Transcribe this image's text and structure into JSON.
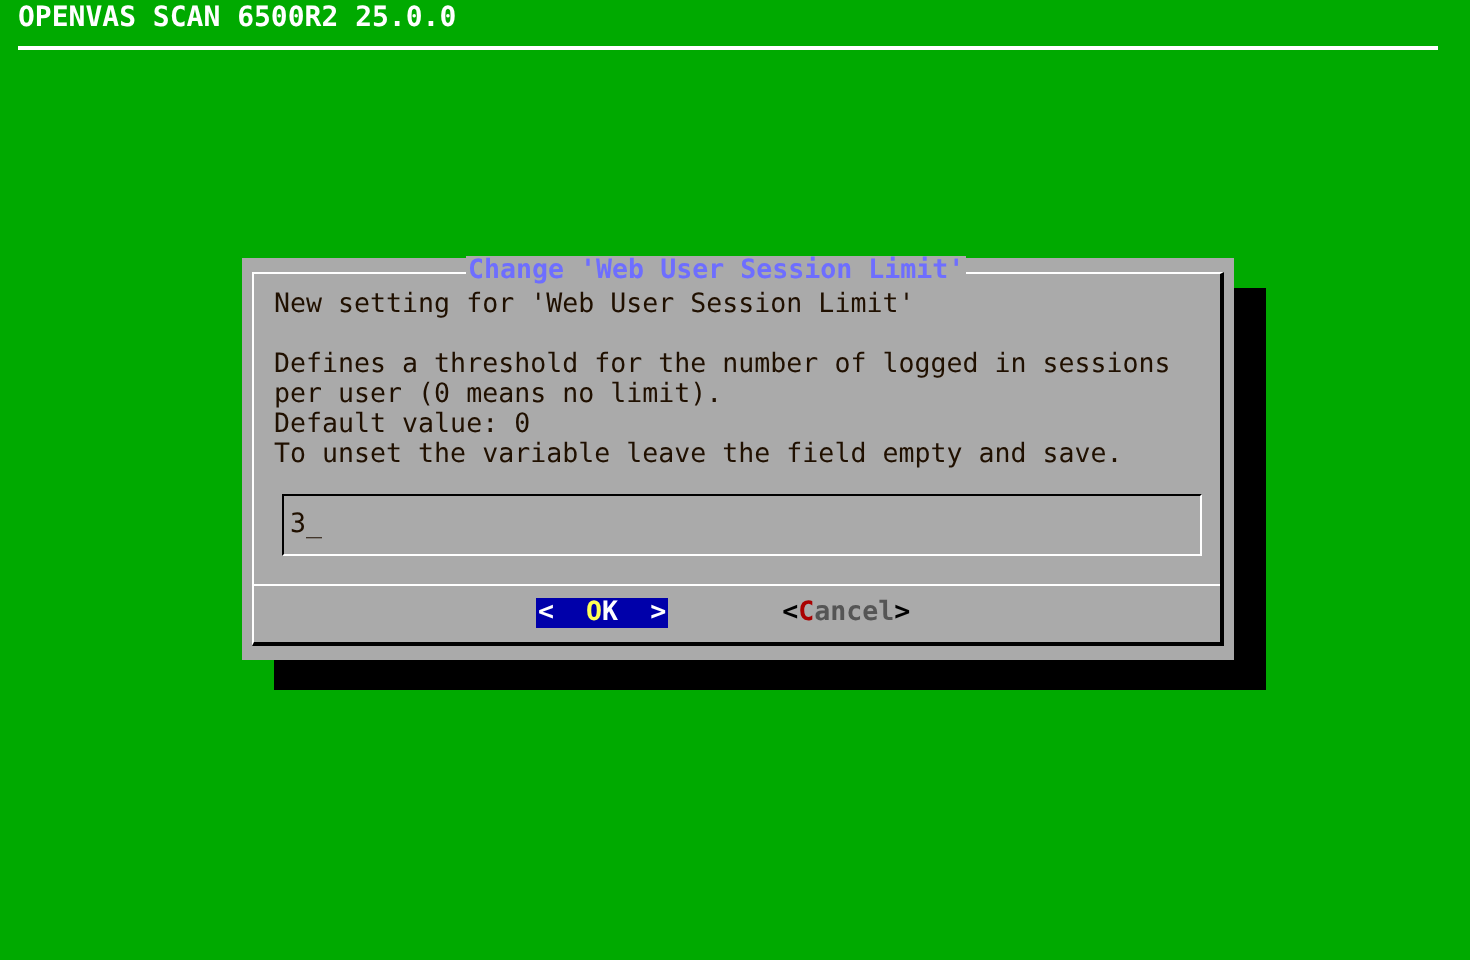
{
  "screen_title": "OPENVAS SCAN 6500R2 25.0.0",
  "dialog": {
    "title": "Change 'Web User Session Limit'",
    "paragraphs": [
      [
        "New setting for 'Web User Session Limit'"
      ],
      [
        "Defines a threshold for the number of logged in sessions",
        "per user (0 means no limit).",
        "Default value: 0",
        "To unset the variable leave the field empty and save."
      ]
    ],
    "input": {
      "value": "3_"
    },
    "buttons": [
      {
        "left": "<  ",
        "hotkey": "O",
        "rest": "K",
        "right": "  >",
        "selected": true
      },
      {
        "left": "<",
        "hotkey": "C",
        "rest": "ancel",
        "right": ">",
        "selected": false
      }
    ]
  }
}
